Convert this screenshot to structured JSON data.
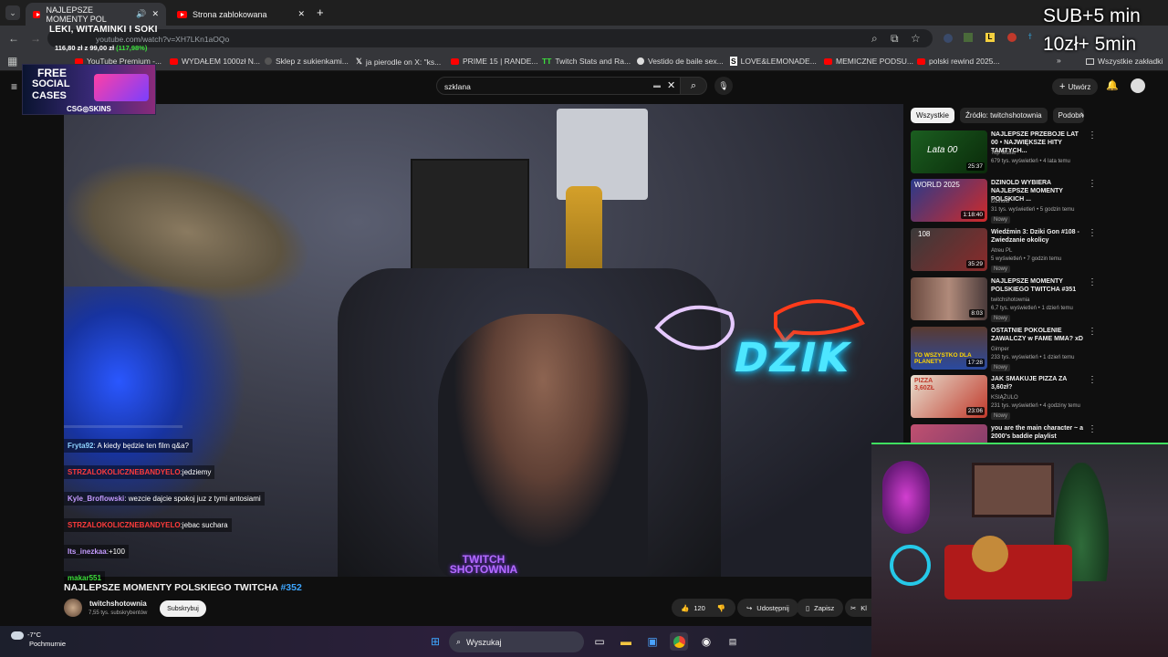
{
  "browser": {
    "tabs": [
      {
        "label": "NAJLEPSZE MOMENTY POL",
        "active": true
      },
      {
        "label": "Strona zablokowana",
        "active": false
      }
    ],
    "url": "youtube.com/watch?v=XH7LKn1aOQo",
    "bookmarks": [
      "YouTube Premium -...",
      "WYDAŁEM 1000zł N...",
      "Sklep z sukienkami...",
      "ja pierodle on X: \"ks...",
      "PRIME 15 | RANDE...",
      "Twitch Stats and Ra...",
      "Vestido de baile sex...",
      "LOVE&LEMONADE...",
      "MEMICZNE PODSU...",
      "polski rewind 2025...",
      "Wszystkie zakładki"
    ]
  },
  "youtube": {
    "search_value": "szklana",
    "create_label": "Utwórz",
    "video_title": "NAJLEPSZE MOMENTY POLSKIEGO TWITCHA",
    "video_tag": "#352",
    "channel": "twitchshotownia",
    "channel_subs": "7,55 tys. subskrybentów",
    "subscribe_label": "Subskrybuj",
    "likes": "120",
    "share_label": "Udostępnij",
    "save_label": "Zapisz",
    "clip_label": "Kl",
    "chips": [
      "Wszystkie",
      "Źródło: twitchshotownia",
      "Podobne"
    ],
    "recommendations": [
      {
        "title": "NAJLEPSZE PRZEBOJE LAT 00 • NAJWIĘKSZE HITY TAMTYCH...",
        "channel": "Top Music",
        "meta": "679 tys. wyświetleń • 4 lata temu",
        "duration": "25:37",
        "new": "",
        "thumb_text": "Lata 00"
      },
      {
        "title": "DZINOLD WYBIERA NAJLEPSZE MOMENTY POLSKICH ...",
        "channel": "Dzinold",
        "meta": "31 tys. wyświetleń • 5 godzin temu",
        "duration": "1:18:40",
        "new": "Nowy",
        "thumb_text": "WORLD 2025"
      },
      {
        "title": "Wiedźmin 3: Dziki Gon #108 - Zwiedzanie okolicy",
        "channel": "Atreu PL",
        "meta": "5 wyświetleń • 7 godzin temu",
        "duration": "35:29",
        "new": "Nowy",
        "thumb_text": "108"
      },
      {
        "title": "NAJLEPSZE MOMENTY POLSKIEGO TWITCHA #351",
        "channel": "twitchshotownia",
        "meta": "6,7 tys. wyświetleń • 1 dzień temu",
        "duration": "8:03",
        "new": "Nowy",
        "thumb_text": ""
      },
      {
        "title": "OSTATNIE POKOLENIE ZAWALCZY w FAME MMA? xD",
        "channel": "Gimper",
        "meta": "233 tys. wyświetleń • 1 dzień temu",
        "duration": "17:28",
        "new": "Nowy",
        "thumb_text": "TO WSZYSTKO DLA PLANETY"
      },
      {
        "title": "JAK SMAKUJE PIZZA ZA 3,60zł?",
        "channel": "KSIĄŻULO",
        "meta": "231 tys. wyświetleń • 4 godziny temu",
        "duration": "23:06",
        "new": "Nowy",
        "thumb_text": "PIZZA 3,60ZŁ"
      },
      {
        "title": "you are the main character ~ a 2000's baddie playlist",
        "channel": "",
        "meta": "",
        "duration": "",
        "new": "",
        "thumb_text": ""
      }
    ]
  },
  "overlay": {
    "stream_title": "LEKI, WITAMINKI I SOKI",
    "price_main": "116,80 zł z 99,00 zł",
    "price_pct": "(117,98%)",
    "csg": {
      "line1": "FREE",
      "line2": "SOCIAL",
      "line3": "CASES",
      "brand": "CSG◎SKINS"
    },
    "sub_line1": "SUB+5 min",
    "sub_line2": "10zł+ 5min",
    "neon": "DZIK",
    "watermark_1": "TWITCH",
    "watermark_2": "SHOTOWNIA"
  },
  "chat": [
    {
      "user": "Fryta92",
      "sep": ":",
      "msg": "A kiedy będzie ten film q&a?",
      "color": "#8fd3ff"
    },
    {
      "user": "STRZALOKOLICZNEBANDYELO",
      "sep": ":",
      "msg": "jedziemy",
      "color": "#ff3b3b"
    },
    {
      "user": "Kyle_Broflowski",
      "sep": ":",
      "msg": "wezcie dajcie spokoj juz z tymi antosiami",
      "color": "#c49bff"
    },
    {
      "user": "STRZALOKOLICZNEBANDYELO",
      "sep": ":",
      "msg": "jebac suchara",
      "color": "#ff3b3b"
    },
    {
      "user": "Its_inezkaa",
      "sep": ":",
      "msg": "+100",
      "color": "#c49bff"
    },
    {
      "user": "makar551",
      "sep": "",
      "msg": "",
      "color": "#3de03d"
    }
  ],
  "taskbar": {
    "temp": "-7°C",
    "weather": "Pochmurnie",
    "search_label": "Wyszukaj"
  },
  "colors": {
    "yt_red": "#ff0000",
    "accent_blue": "#3ea6ff",
    "neon_cyan": "#4de6ff",
    "neon_red": "#ff3b1a"
  }
}
